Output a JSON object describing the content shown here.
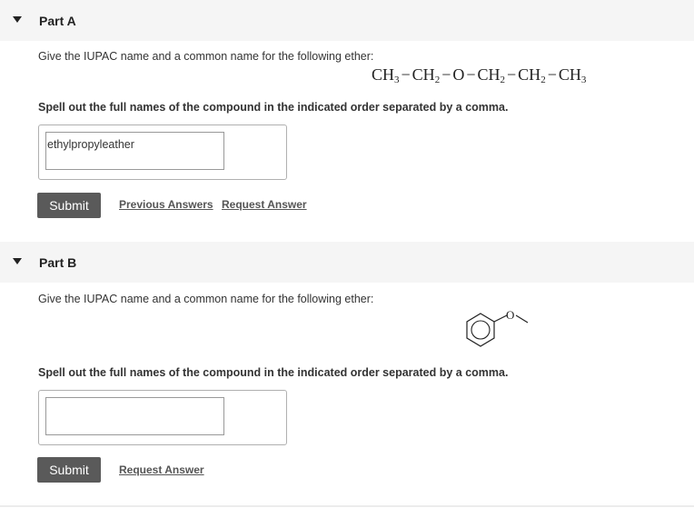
{
  "part_a": {
    "title": "Part A",
    "prompt": "Give the IUPAC name and a common name for the following ether:",
    "formula": {
      "ch3_a": "CH",
      "ch3_a_sub": "3",
      "ch2_a": "CH",
      "ch2_a_sub": "2",
      "o": "O",
      "ch2_b": "CH",
      "ch2_b_sub": "2",
      "ch2_c": "CH",
      "ch2_c_sub": "2",
      "ch3_b": "CH",
      "ch3_b_sub": "3",
      "bond": "−"
    },
    "instruction": "Spell out the full names of the compound in the indicated order separated by a comma.",
    "answer_value": "ethylpropyleather",
    "submit_label": "Submit",
    "previous_answers_label": "Previous Answers",
    "request_answer_label": "Request Answer"
  },
  "part_b": {
    "title": "Part B",
    "prompt": "Give the IUPAC name and a common name for the following ether:",
    "structure_atom": "O",
    "instruction": "Spell out the full names of the compound in the indicated order separated by a comma.",
    "answer_value": "",
    "submit_label": "Submit",
    "request_answer_label": "Request Answer"
  }
}
